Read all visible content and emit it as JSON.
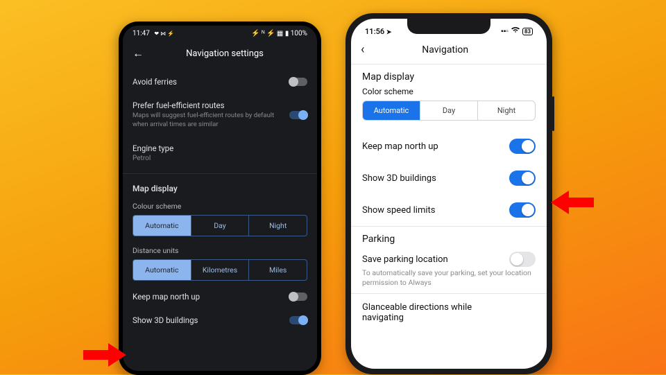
{
  "android": {
    "status": {
      "time": "11:47",
      "icons_left": "❤ ⋈ ⚡",
      "icons_right": "⚡ ᴺ ⚡ ▦ ▮ 100%"
    },
    "title": "Navigation settings",
    "avoid_ferries": {
      "label": "Avoid ferries"
    },
    "fuel": {
      "label": "Prefer fuel-efficient routes",
      "sub": "Maps will suggest fuel-efficient routes by default when arrival times are similar"
    },
    "engine": {
      "label": "Engine type",
      "value": "Petrol"
    },
    "map_display": {
      "title": "Map display"
    },
    "colour_scheme": {
      "label": "Colour scheme",
      "opts": [
        "Automatic",
        "Day",
        "Night"
      ]
    },
    "distance_units": {
      "label": "Distance units",
      "opts": [
        "Automatic",
        "Kilometres",
        "Miles"
      ]
    },
    "keep_north": {
      "label": "Keep map north up"
    },
    "show_3d": {
      "label": "Show 3D buildings"
    }
  },
  "ios": {
    "status": {
      "time": "11:56",
      "loc_icon": "➤",
      "right": "▪▮ ⚡ 83"
    },
    "title": "Navigation",
    "map_display": {
      "title": "Map display"
    },
    "color_scheme": {
      "label": "Color scheme",
      "opts": [
        "Automatic",
        "Day",
        "Night"
      ]
    },
    "keep_north": {
      "label": "Keep map north up"
    },
    "show_3d": {
      "label": "Show 3D buildings"
    },
    "speed_limits": {
      "label": "Show speed limits"
    },
    "parking": {
      "title": "Parking"
    },
    "save_parking": {
      "label": "Save parking location",
      "sub": "To automatically save your parking, set your location permission to Always"
    },
    "glanceable": {
      "label": "Glanceable directions while navigating"
    }
  }
}
